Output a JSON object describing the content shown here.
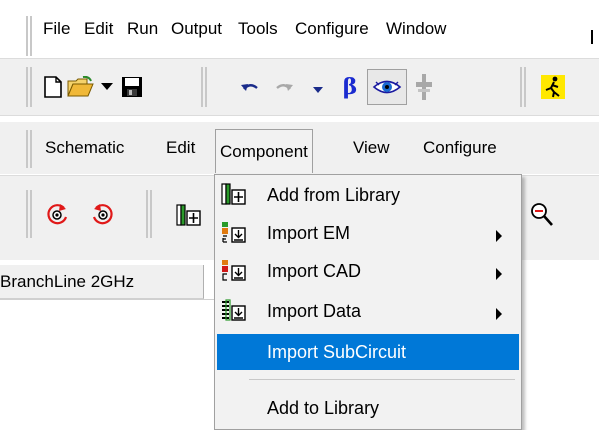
{
  "menubar": {
    "items": [
      {
        "label": "File"
      },
      {
        "label": "Edit"
      },
      {
        "label": "Run"
      },
      {
        "label": "Output"
      },
      {
        "label": "Tools"
      },
      {
        "label": "Configure"
      },
      {
        "label": "Window"
      }
    ]
  },
  "toolbar_main": {
    "icons": [
      "new-file-icon",
      "open-folder-icon",
      "dropdown-arrow-icon",
      "save-icon",
      "undo-icon",
      "redo-icon",
      "dropdown-arrow-icon",
      "beta-icon",
      "eye-icon",
      "tune-icon",
      "run-icon"
    ],
    "beta_symbol": "β"
  },
  "schematic_menu": {
    "items": [
      {
        "label": "Schematic"
      },
      {
        "label": "Edit"
      },
      {
        "label": "Component"
      },
      {
        "label": "View"
      },
      {
        "label": "Configure"
      }
    ]
  },
  "schematic_toolbar": {
    "icons": [
      "rotate-ccw-icon",
      "rotate-cw-icon",
      "add-from-library-icon",
      "zoom-out-icon"
    ]
  },
  "tab": {
    "label": "BranchLine 2GHz"
  },
  "component_menu": {
    "items": [
      {
        "label": "Add from Library",
        "icon": "add-from-library-icon",
        "submenu": false,
        "selected": false
      },
      {
        "label": "Import EM",
        "icon": "import-em-icon",
        "submenu": true,
        "selected": false
      },
      {
        "label": "Import CAD",
        "icon": "import-cad-icon",
        "submenu": true,
        "selected": false
      },
      {
        "label": "Import Data",
        "icon": "import-data-icon",
        "submenu": true,
        "selected": false
      },
      {
        "label": "Import SubCircuit",
        "icon": "",
        "submenu": false,
        "selected": true
      },
      {
        "label": "Add to Library",
        "icon": "",
        "submenu": false,
        "selected": false
      }
    ]
  },
  "colors": {
    "highlight": "#0078d7",
    "menu_bg": "#f2f2f2",
    "toolbar_bg": "#f0f0f0"
  }
}
